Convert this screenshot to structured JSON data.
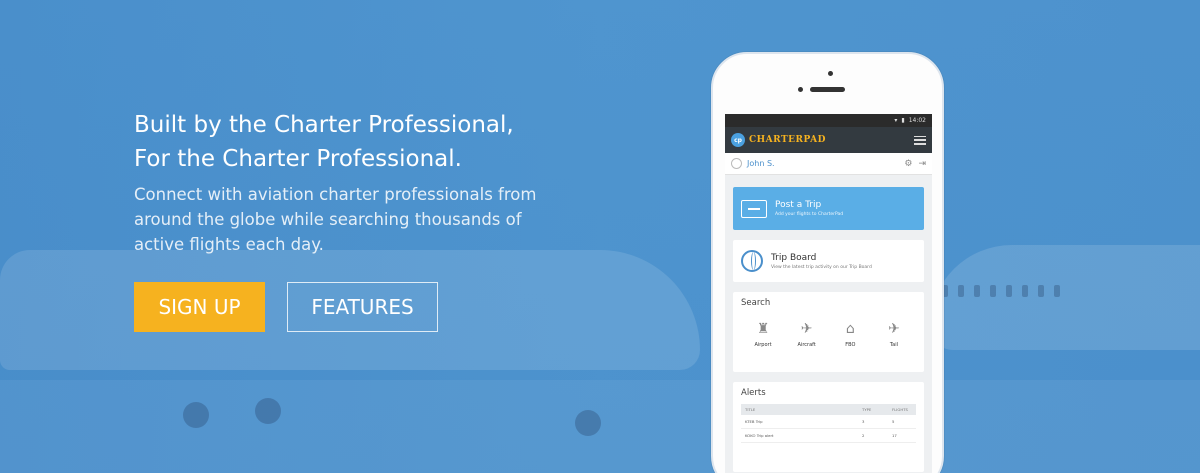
{
  "hero": {
    "headline_line1": "Built by the Charter Professional,",
    "headline_line2": "For the Charter Professional.",
    "subtext": "Connect with aviation charter professionals from around the globe while searching thousands of active flights each day.",
    "signup_label": "SIGN UP",
    "features_label": "FEATURES"
  },
  "colors": {
    "background_blue": "#4a8fcb",
    "signup_yellow": "#f6b21f",
    "post_card_blue": "#5aaee6"
  },
  "app": {
    "status_time": "14:02",
    "brand_badge": "cp",
    "brand_name": "CHARTERPAD",
    "user_name": "John S.",
    "post_trip": {
      "title": "Post a Trip",
      "subtitle": "Add your flights to CharterPad"
    },
    "trip_board": {
      "title": "Trip Board",
      "subtitle": "View the latest trip activity on our Trip Board"
    },
    "search": {
      "title": "Search",
      "items": [
        {
          "label": "Airport",
          "icon": "airport-icon"
        },
        {
          "label": "Aircraft",
          "icon": "aircraft-icon"
        },
        {
          "label": "FBO",
          "icon": "fbo-icon"
        },
        {
          "label": "Tail",
          "icon": "tail-icon"
        }
      ]
    },
    "alerts": {
      "title": "Alerts",
      "columns": [
        "TITLE",
        "TYPE",
        "FLIGHTS"
      ],
      "rows": [
        [
          "KTEB Trip",
          "3",
          "5"
        ],
        [
          "KOKO Trip alert",
          "2",
          "17"
        ]
      ]
    }
  }
}
